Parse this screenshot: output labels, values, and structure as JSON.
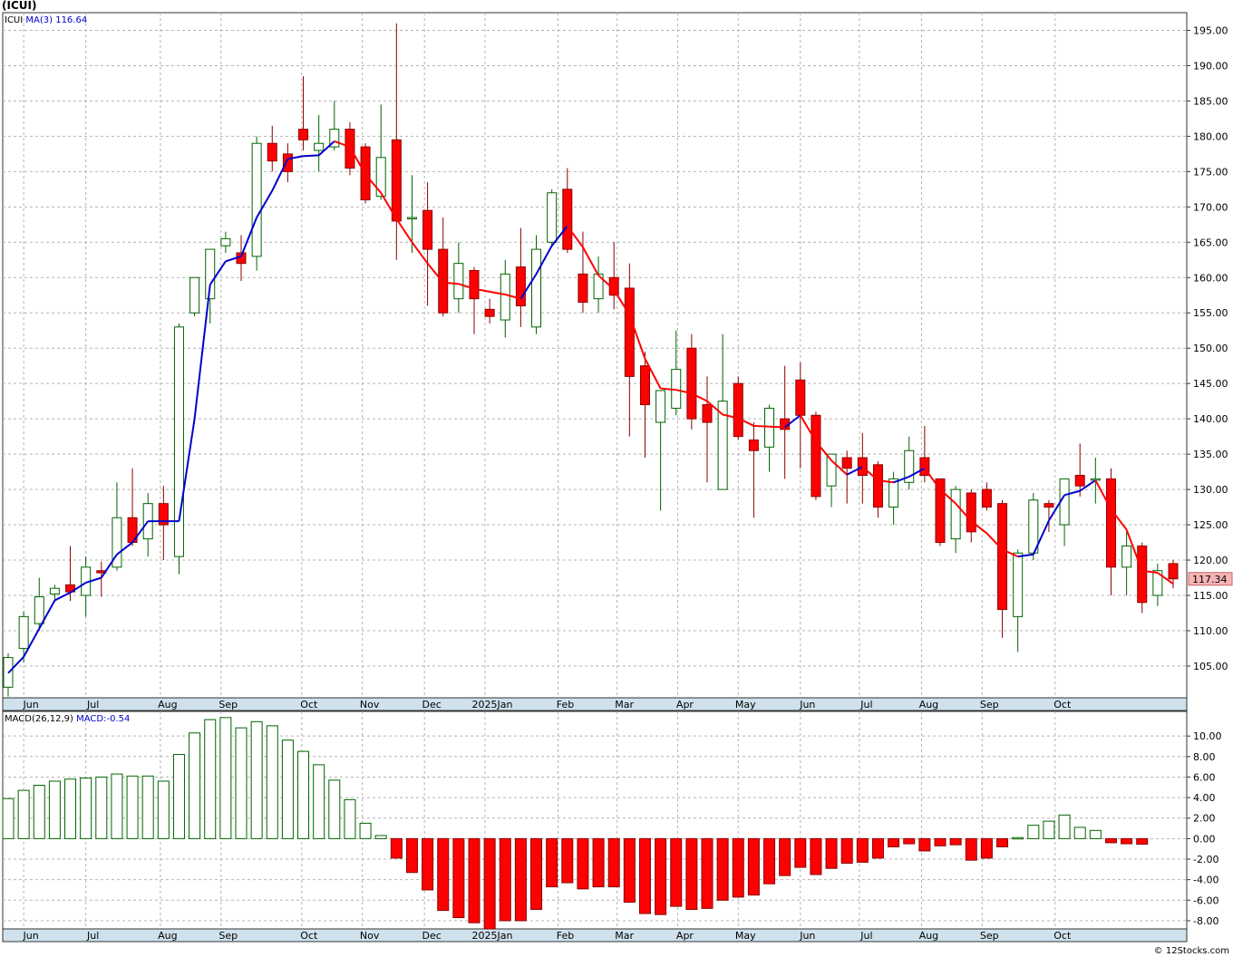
{
  "ticker_title": "(ICUI)",
  "footer": "© 12Stocks.com",
  "price_panel": {
    "symbol_label": "ICUI",
    "ma_label": "MA(3)",
    "ma_value": "116.64",
    "last_price_tag": "117.34"
  },
  "macd_panel": {
    "label": "MACD(26,12,9)",
    "value_label": "MACD:-0.54"
  },
  "colors": {
    "up_candle_fill": "#ffffff",
    "up_candle_stroke": "#006400",
    "down_candle_fill": "#ff0000",
    "down_candle_stroke": "#8b0000",
    "ma_up": "#0000cc",
    "ma_down": "#ff0000",
    "grid": "#b4b4b4",
    "axis_band": "#cfe1ec"
  },
  "chart_data": [
    {
      "type": "candlestick",
      "title": "(ICUI)",
      "x_tick_labels": [
        "Jun",
        "Jul",
        "Aug",
        "Sep",
        "Oct",
        "Nov",
        "Dec",
        "2025Jan",
        "Feb",
        "Mar",
        "Apr",
        "May",
        "Jun",
        "Jul",
        "Aug",
        "Sep",
        "Oct"
      ],
      "y_tick_labels": [
        "105.00",
        "110.00",
        "115.00",
        "120.00",
        "125.00",
        "130.00",
        "135.00",
        "140.00",
        "145.00",
        "150.00",
        "155.00",
        "160.00",
        "165.00",
        "170.00",
        "175.00",
        "180.00",
        "185.00",
        "190.00",
        "195.00"
      ],
      "ylim": [
        100.5,
        197.5
      ],
      "series": [
        {
          "name": "ICUI",
          "ohlc": [
            [
              102.0,
              106.8,
              100.7,
              106.2
            ],
            [
              107.5,
              112.7,
              105.5,
              112.0
            ],
            [
              111.0,
              117.5,
              110.0,
              114.8
            ],
            [
              115.2,
              116.5,
              114.0,
              116.0
            ],
            [
              116.5,
              122.0,
              114.2,
              115.5
            ],
            [
              115.0,
              120.5,
              112.0,
              119.0
            ],
            [
              118.5,
              119.8,
              114.8,
              118.2
            ],
            [
              119.0,
              131.0,
              118.5,
              126.0
            ],
            [
              126.0,
              133.0,
              122.0,
              122.5
            ],
            [
              123.0,
              129.5,
              120.5,
              128.0
            ],
            [
              128.0,
              130.5,
              120.0,
              125.0
            ],
            [
              120.5,
              153.5,
              118.0,
              153.0
            ],
            [
              155.0,
              159.5,
              154.5,
              160.0
            ],
            [
              157.0,
              163.0,
              153.5,
              164.0
            ],
            [
              164.5,
              166.5,
              163.5,
              165.5
            ],
            [
              163.5,
              166.0,
              159.5,
              162.0
            ],
            [
              163.0,
              180.0,
              161.0,
              179.0
            ],
            [
              179.0,
              181.5,
              175.0,
              176.5
            ],
            [
              177.5,
              179.0,
              173.5,
              175.0
            ],
            [
              181.0,
              188.5,
              178.0,
              179.5
            ],
            [
              178.0,
              183.0,
              175.0,
              179.0
            ],
            [
              178.5,
              185.0,
              178.0,
              181.0
            ],
            [
              181.0,
              182.0,
              174.5,
              175.5
            ],
            [
              178.5,
              179.0,
              170.5,
              171.0
            ],
            [
              171.5,
              184.5,
              171.0,
              177.0
            ],
            [
              179.5,
              196.0,
              162.5,
              168.0
            ],
            [
              168.5,
              174.5,
              163.5,
              168.5
            ],
            [
              169.5,
              173.5,
              156.0,
              164.0
            ],
            [
              164.0,
              168.5,
              154.5,
              155.0
            ],
            [
              157.0,
              165.0,
              155.0,
              162.0
            ],
            [
              161.0,
              161.5,
              152.0,
              157.0
            ],
            [
              155.5,
              157.0,
              153.5,
              154.5
            ],
            [
              154.0,
              162.5,
              151.5,
              160.5
            ],
            [
              161.5,
              167.0,
              153.0,
              156.0
            ],
            [
              153.0,
              166.0,
              152.0,
              164.0
            ],
            [
              165.0,
              172.5,
              164.5,
              172.0
            ],
            [
              172.5,
              175.5,
              163.5,
              164.0
            ],
            [
              160.5,
              166.5,
              155.0,
              156.5
            ],
            [
              157.0,
              163.0,
              155.0,
              160.5
            ],
            [
              160.0,
              165.0,
              155.5,
              157.5
            ],
            [
              158.5,
              162.0,
              137.5,
              146.0
            ],
            [
              147.5,
              149.5,
              134.5,
              142.0
            ],
            [
              139.5,
              144.0,
              127.0,
              144.0
            ],
            [
              141.5,
              152.5,
              140.5,
              147.0
            ],
            [
              150.0,
              152.0,
              138.5,
              140.0
            ],
            [
              142.0,
              146.0,
              131.0,
              139.5
            ],
            [
              130.0,
              152.0,
              130.0,
              142.5
            ],
            [
              145.0,
              146.0,
              137.0,
              137.5
            ],
            [
              137.0,
              139.5,
              126.0,
              135.5
            ],
            [
              136.0,
              142.0,
              132.5,
              141.5
            ],
            [
              140.0,
              147.5,
              131.5,
              138.5
            ],
            [
              145.5,
              148.0,
              133.0,
              140.5
            ],
            [
              140.5,
              141.0,
              128.5,
              129.0
            ],
            [
              130.5,
              135.0,
              127.5,
              135.0
            ],
            [
              134.5,
              135.5,
              128.0,
              133.0
            ],
            [
              134.5,
              138.0,
              128.0,
              132.0
            ],
            [
              133.5,
              134.0,
              126.0,
              127.5
            ],
            [
              127.5,
              132.5,
              125.0,
              131.5
            ],
            [
              131.0,
              137.5,
              130.0,
              135.5
            ],
            [
              134.5,
              139.0,
              131.0,
              132.0
            ],
            [
              131.5,
              131.5,
              122.0,
              122.5
            ],
            [
              123.0,
              130.5,
              121.0,
              130.0
            ],
            [
              129.5,
              130.0,
              122.5,
              124.0
            ],
            [
              130.0,
              131.0,
              127.0,
              127.5
            ],
            [
              128.0,
              128.5,
              109.0,
              113.0
            ],
            [
              112.0,
              121.5,
              107.0,
              121.0
            ],
            [
              121.0,
              129.5,
              120.0,
              128.5
            ],
            [
              128.0,
              128.5,
              124.0,
              127.5
            ],
            [
              125.0,
              131.5,
              122.0,
              131.5
            ],
            [
              132.0,
              136.5,
              129.0,
              130.5
            ],
            [
              131.5,
              134.5,
              128.0,
              131.5
            ],
            [
              131.5,
              133.0,
              115.0,
              119.0
            ],
            [
              119.0,
              124.0,
              115.0,
              122.0
            ],
            [
              122.0,
              122.5,
              112.5,
              114.0
            ],
            [
              115.0,
              119.5,
              113.5,
              118.5
            ],
            [
              119.5,
              120.0,
              116.0,
              117.34
            ]
          ]
        },
        {
          "name": "MA(3)",
          "values": [
            104.0,
            106.3,
            110.3,
            114.3,
            115.4,
            116.8,
            117.5,
            120.8,
            122.5,
            125.5,
            125.5,
            125.5,
            140.0,
            159.0,
            162.3,
            163.0,
            168.5,
            172.3,
            176.8,
            177.2,
            177.3,
            179.3,
            178.5,
            174.6,
            172.0,
            168.3,
            165.0,
            162.0,
            159.3,
            159.1,
            158.4,
            158.0,
            157.6,
            157.0,
            160.5,
            164.5,
            167.3,
            164.3,
            160.3,
            158.3,
            154.7,
            148.5,
            144.3,
            144.1,
            143.6,
            142.5,
            140.6,
            140.1,
            139.0,
            138.9,
            138.8,
            140.5,
            136.8,
            134.1,
            132.1,
            133.2,
            131.3,
            131.0,
            131.8,
            133.0,
            130.0,
            128.0,
            125.5,
            123.8,
            121.5,
            120.5,
            120.8,
            125.6,
            129.2,
            129.8,
            131.3,
            127.2,
            124.3,
            118.5,
            118.2,
            116.64
          ]
        }
      ]
    },
    {
      "type": "bar",
      "title": "MACD(26,12,9)",
      "x_tick_labels": [
        "Jun",
        "Jul",
        "Aug",
        "Sep",
        "Oct",
        "Nov",
        "Dec",
        "2025Jan",
        "Feb",
        "Mar",
        "Apr",
        "May",
        "Jun",
        "Jul",
        "Aug",
        "Sep",
        "Oct"
      ],
      "y_tick_labels": [
        "10.00",
        "8.00",
        "6.00",
        "4.00",
        "2.00",
        "0.00",
        "-2.00",
        "-4.00",
        "-6.00",
        "-8.00"
      ],
      "ylim": [
        -8.8,
        12.4
      ],
      "series": [
        {
          "name": "MACD",
          "values": [
            3.9,
            4.7,
            5.2,
            5.6,
            5.8,
            5.9,
            6.0,
            6.3,
            6.1,
            6.1,
            5.6,
            8.2,
            10.3,
            11.6,
            11.8,
            10.8,
            11.4,
            11.0,
            9.6,
            8.5,
            7.2,
            5.7,
            3.8,
            1.5,
            0.3,
            -1.9,
            -3.3,
            -5.0,
            -7.0,
            -7.7,
            -8.2,
            -8.8,
            -8.0,
            -8.0,
            -6.9,
            -4.7,
            -4.3,
            -4.9,
            -4.7,
            -4.7,
            -6.2,
            -7.3,
            -7.4,
            -6.6,
            -6.9,
            -6.8,
            -6.0,
            -5.7,
            -5.5,
            -4.4,
            -3.6,
            -2.8,
            -3.5,
            -2.9,
            -2.4,
            -2.3,
            -1.9,
            -0.8,
            -0.5,
            -1.2,
            -0.7,
            -0.6,
            -2.1,
            -1.9,
            -0.8,
            0.1,
            1.3,
            1.7,
            2.3,
            1.1,
            0.8,
            -0.4,
            -0.5,
            -0.54
          ]
        }
      ]
    }
  ]
}
